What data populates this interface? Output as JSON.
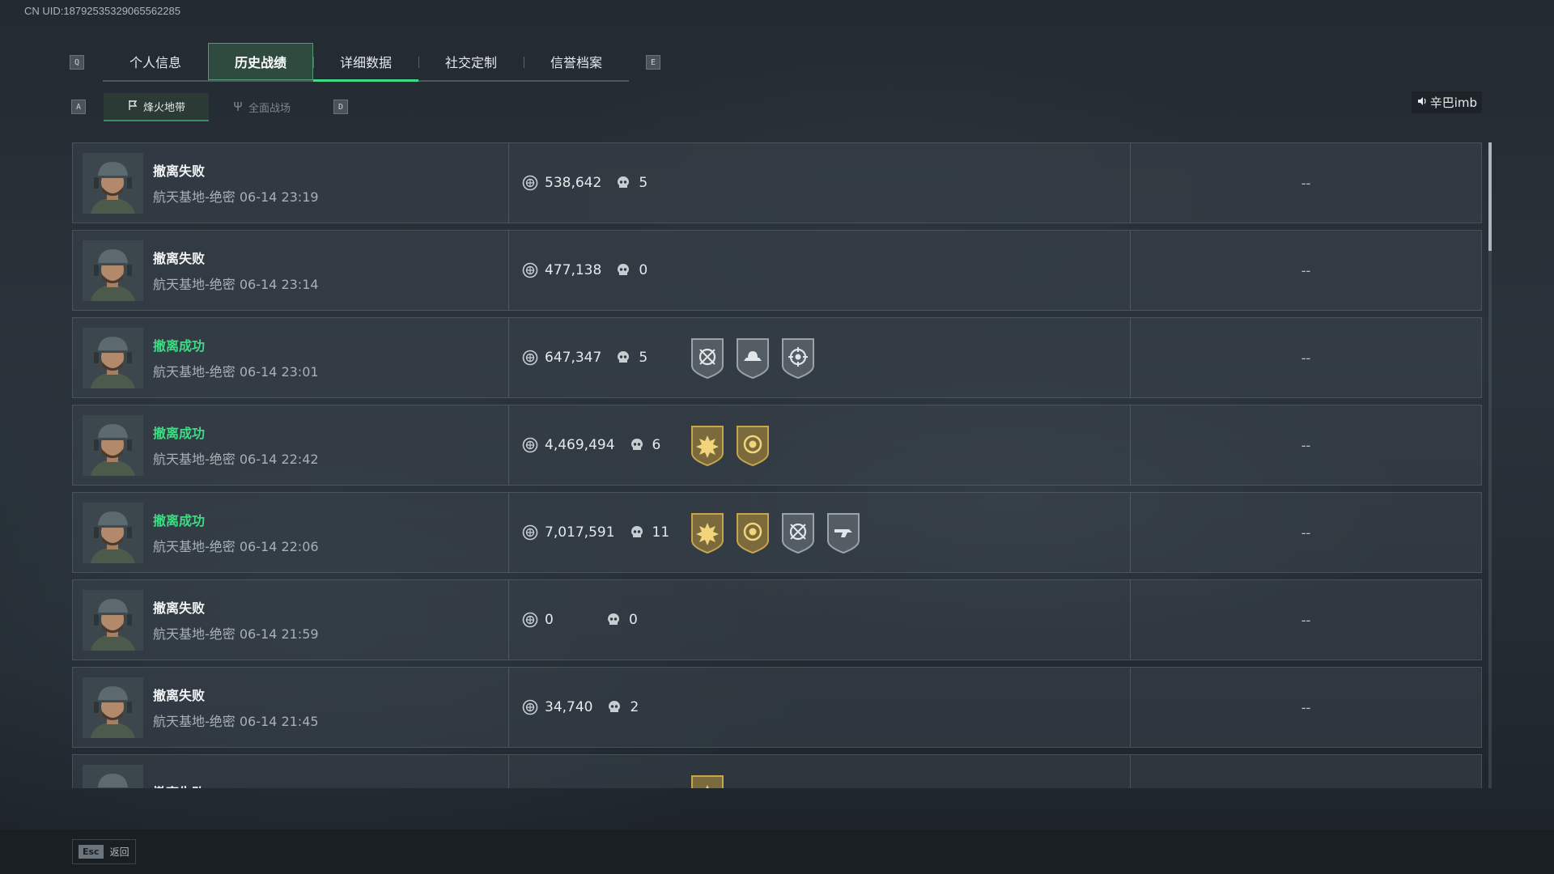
{
  "uid": "CN UID:18792535329065562285",
  "keys": {
    "prev_tab": "Q",
    "next_tab": "E",
    "prev_mode": "A",
    "next_mode": "D"
  },
  "tabs": [
    {
      "label": "个人信息"
    },
    {
      "label": "历史战绩"
    },
    {
      "label": "详细数据"
    },
    {
      "label": "社交定制"
    },
    {
      "label": "信誉档案"
    }
  ],
  "active_tab": 1,
  "modes": [
    {
      "label": "烽火地带",
      "icon": "flag-icon"
    },
    {
      "label": "全面战场",
      "icon": "trident-icon"
    }
  ],
  "active_mode": 0,
  "player_tag": "辛巴imb",
  "colors": {
    "success": "#3ddc84",
    "accent": "#3ddc84"
  },
  "matches": [
    {
      "result": "撤离失败",
      "success": false,
      "map_time": "航天基地-绝密 06-14 23:19",
      "value": "538,642",
      "kills": "5",
      "medals": [],
      "extra": "--"
    },
    {
      "result": "撤离失败",
      "success": false,
      "map_time": "航天基地-绝密 06-14 23:14",
      "value": "477,138",
      "kills": "0",
      "medals": [],
      "extra": "--"
    },
    {
      "result": "撤离成功",
      "success": true,
      "map_time": "航天基地-绝密 06-14 23:01",
      "value": "647,347",
      "kills": "5",
      "medals": [
        "silver-crosshair-medal-icon",
        "silver-hat-medal-icon",
        "silver-target-medal-icon"
      ],
      "extra": "--"
    },
    {
      "result": "撤离成功",
      "success": true,
      "map_time": "航天基地-绝密 06-14 22:42",
      "value": "4,469,494",
      "kills": "6",
      "medals": [
        "gold-burst-medal-icon",
        "gold-coin-medal-icon"
      ],
      "extra": "--"
    },
    {
      "result": "撤离成功",
      "success": true,
      "map_time": "航天基地-绝密 06-14 22:06",
      "value": "7,017,591",
      "kills": "11",
      "medals": [
        "gold-burst-medal-icon",
        "gold-coin-medal-icon",
        "silver-crosshair-medal-icon",
        "silver-gun-medal-icon"
      ],
      "extra": "--"
    },
    {
      "result": "撤离失败",
      "success": false,
      "map_time": "航天基地-绝密 06-14 21:59",
      "value": "0",
      "kills": "0",
      "medals": [],
      "extra": "--"
    },
    {
      "result": "撤离失败",
      "success": false,
      "map_time": "航天基地-绝密 06-14 21:45",
      "value": "34,740",
      "kills": "2",
      "medals": [],
      "extra": "--"
    },
    {
      "result": "撤离失败",
      "success": false,
      "map_time": "",
      "value": "",
      "kills": "",
      "medals": [
        "gold-burst-medal-icon"
      ],
      "extra": ""
    }
  ],
  "footer": {
    "esc_key": "Esc",
    "back_label": "返回"
  }
}
